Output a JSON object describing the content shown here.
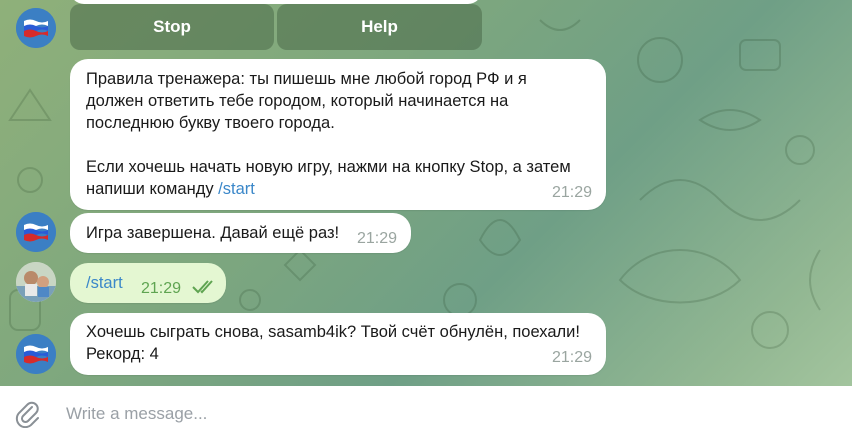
{
  "keyboard": {
    "stop_label": "Stop",
    "help_label": "Help"
  },
  "messages": [
    {
      "sender": "bot",
      "lines": [
        "Правила тренажера: ты пишешь мне любой город РФ и я",
        "должен ответить тебе городом, который начинается на",
        "последнюю букву твоего города.",
        "",
        "Если хочешь начать новую игру, нажми на кнопку Stop, а затем"
      ],
      "last_line_prefix": "напиши команду ",
      "last_line_link": "/start",
      "time": "21:29"
    },
    {
      "sender": "bot",
      "text": "Игра завершена. Давай ещё раз!",
      "time": "21:29"
    },
    {
      "sender": "user",
      "text": "/start",
      "time": "21:29",
      "status": "read"
    },
    {
      "sender": "bot",
      "lines": [
        "Хочешь сыграть снова, sasamb4ik? Твой счёт обнулён, поехали!",
        "Рекорд: 4"
      ],
      "time": "21:29"
    }
  ],
  "composer": {
    "placeholder": "Write a message..."
  },
  "icons": {
    "attach": "paperclip-icon",
    "bot_avatar": "russian-flag-avatar",
    "read_status": "double-check-icon"
  },
  "colors": {
    "outgoing_bubble": "#e4f7d2",
    "incoming_bubble": "#ffffff",
    "link": "#3a87c9",
    "read_ticks": "#5fa451"
  }
}
